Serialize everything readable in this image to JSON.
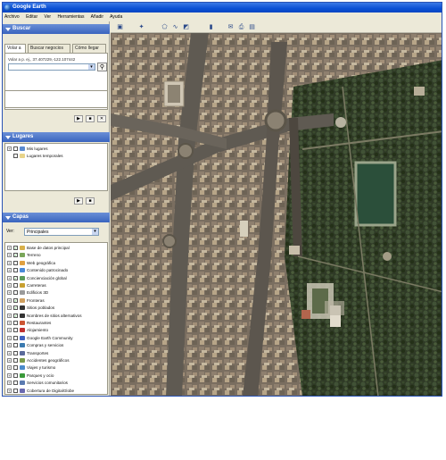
{
  "window": {
    "title": "Google Earth"
  },
  "menu": [
    "Archivo",
    "Editar",
    "Ver",
    "Herramientas",
    "Añadir",
    "Ayuda"
  ],
  "search_panel": {
    "title": "Buscar",
    "tabs": [
      "Volar a",
      "Buscar negocios",
      "Cómo llegar"
    ],
    "active_tab": "Volar a",
    "hint": "Volar a p. ej., 37.407229,-122.107442",
    "input_value": "",
    "dropdown_icon": "chevron-down-icon",
    "search_icon": "magnifier-icon"
  },
  "places_panel": {
    "title": "Lugares",
    "items": [
      {
        "label": "Mis lugares",
        "expanded": false,
        "checked": false,
        "icon": "globe-folder-icon"
      },
      {
        "label": "Lugares temporales",
        "expanded": false,
        "checked": false,
        "icon": "folder-icon"
      }
    ]
  },
  "layers_panel": {
    "title": "Capas",
    "view_label": "Ver:",
    "view_value": "Principales",
    "items": [
      {
        "label": "Base de datos principal",
        "checked": true,
        "icon": "database-icon",
        "color": "#d8b04a"
      },
      {
        "label": "Terreno",
        "checked": true,
        "icon": "terrain-icon",
        "color": "#7aa65a"
      },
      {
        "label": "Web geográfica",
        "checked": false,
        "icon": "web-icon",
        "color": "#e0a040"
      },
      {
        "label": "Contenido patrocinado",
        "checked": false,
        "icon": "sponsor-icon",
        "color": "#4a8ad8"
      },
      {
        "label": "Concienciación global",
        "checked": true,
        "icon": "globe-icon",
        "color": "#5a9a5a"
      },
      {
        "label": "Carreteras",
        "checked": false,
        "icon": "road-icon",
        "color": "#c8a030"
      },
      {
        "label": "Edificios 3D",
        "checked": false,
        "icon": "building-icon",
        "color": "#9a9a9a"
      },
      {
        "label": "Fronteras",
        "checked": true,
        "icon": "border-icon",
        "color": "#d0a060"
      },
      {
        "label": "Sitios poblados",
        "checked": true,
        "icon": "dot-icon",
        "color": "#333333"
      },
      {
        "label": "Nombres de sitios alternativos",
        "checked": true,
        "icon": "dot-icon",
        "color": "#333333"
      },
      {
        "label": "Restaurantes",
        "checked": false,
        "icon": "restaurant-icon",
        "color": "#cc5533"
      },
      {
        "label": "Alojamiento",
        "checked": false,
        "icon": "hotel-icon",
        "color": "#c03030"
      },
      {
        "label": "Google Earth Community",
        "checked": false,
        "icon": "community-icon",
        "color": "#4060c0"
      },
      {
        "label": "Compras y servicios",
        "checked": false,
        "icon": "shopping-icon",
        "color": "#3a7ab0"
      },
      {
        "label": "Transportes",
        "checked": false,
        "icon": "transport-icon",
        "color": "#5a6a9a"
      },
      {
        "label": "Accidentes geográficos",
        "checked": false,
        "icon": "mountain-icon",
        "color": "#7a9a4a"
      },
      {
        "label": "Viajes y turismo",
        "checked": false,
        "icon": "travel-icon",
        "color": "#4a8aca"
      },
      {
        "label": "Parques y ocio",
        "checked": false,
        "icon": "park-icon",
        "color": "#3a9a3a"
      },
      {
        "label": "Servicios comunitarios",
        "checked": false,
        "icon": "services-icon",
        "color": "#5a7ab0"
      },
      {
        "label": "Cobertura de DigitalGlobe",
        "checked": false,
        "icon": "satellite-icon",
        "color": "#6a6ab0"
      }
    ]
  },
  "toolbar": [
    "sidebar-toggle-icon",
    "placemark-icon",
    "polygon-icon",
    "path-icon",
    "image-overlay-icon",
    "ruler-icon",
    "email-icon",
    "print-icon",
    "maps-icon"
  ],
  "map": {
    "description_icon": "satellite-imagery"
  }
}
